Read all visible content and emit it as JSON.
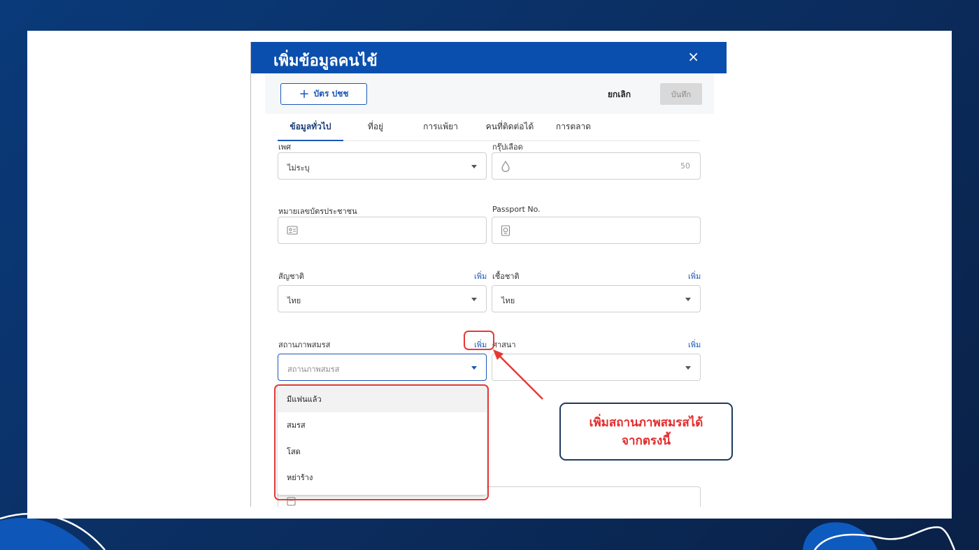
{
  "dialog": {
    "title": "เพิ่มข้อมูลคนไข้",
    "close_icon": "×"
  },
  "toolbar": {
    "id_card_button": "บัตร ปชช",
    "cancel_button": "ยกเลิก",
    "save_button": "บันทึก"
  },
  "tabs": [
    {
      "label": "ข้อมูลทั่วไป",
      "active": true
    },
    {
      "label": "ที่อยู่",
      "active": false
    },
    {
      "label": "การแพ้ยา",
      "active": false
    },
    {
      "label": "คนที่ติดต่อได้",
      "active": false
    },
    {
      "label": "การตลาด",
      "active": false
    }
  ],
  "form": {
    "gender": {
      "label": "เพศ",
      "value": "ไม่ระบุ"
    },
    "blood_group": {
      "label": "กรุ๊ปเลือด",
      "value": "50"
    },
    "national_id": {
      "label": "หมายเลขบัตรประชาชน"
    },
    "passport": {
      "label": "Passport No."
    },
    "nationality": {
      "label": "สัญชาติ",
      "add": "เพิ่ม",
      "value": "ไทย"
    },
    "race": {
      "label": "เชื้อชาติ",
      "add": "เพิ่ม",
      "value": "ไทย"
    },
    "marital_status": {
      "label": "สถานภาพสมรส",
      "add": "เพิ่ม",
      "placeholder": "สถานภาพสมรส"
    },
    "religion": {
      "label": "ศาสนา",
      "add": "เพิ่ม"
    }
  },
  "marital_options": [
    "มีแฟนแล้ว",
    "สมรส",
    "โสด",
    "หย่าร้าง"
  ],
  "annotation": {
    "line1": "เพิ่มสถานภาพสมรสได้",
    "line2": "จากตรงนี้"
  },
  "colors": {
    "header": "#0b4fae",
    "accent": "#1b58b8",
    "annotation_red": "#e53935"
  }
}
